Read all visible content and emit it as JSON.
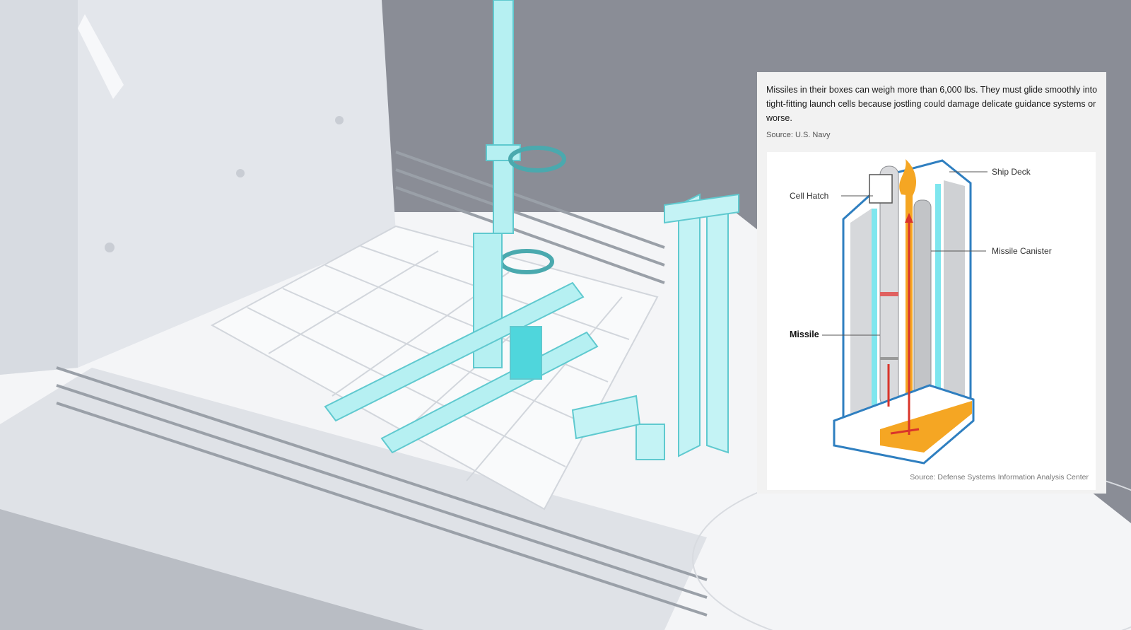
{
  "info_panel": {
    "caption": "Missiles in their boxes can weigh more than 6,000 lbs. They must glide smoothly into tight-fitting launch cells because jostling could damage delicate guidance systems or worse.",
    "source_top": "Source: U.S. Navy",
    "diagram": {
      "labels": {
        "ship_deck": "Ship Deck",
        "cell_hatch": "Cell Hatch",
        "missile_canister": "Missile Canister",
        "missile": "Missile"
      },
      "source_bottom": "Source: Defense Systems Information Analysis Center"
    }
  },
  "colors": {
    "cyan_accent": "#7ee6ee",
    "cell_outline": "#2f7fc0",
    "exhaust_orange": "#f5a623",
    "arrow_red": "#d9342b",
    "panel_background": "#f2f2f2"
  }
}
